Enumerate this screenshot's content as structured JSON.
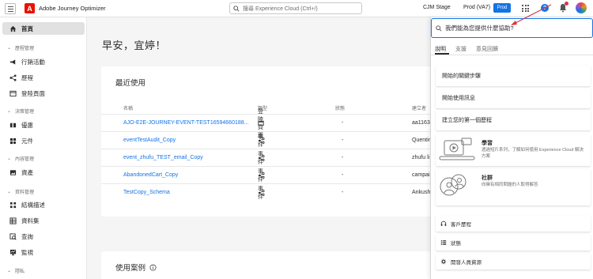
{
  "header": {
    "app_name": "Adobe Journey Optimizer",
    "logo_letter": "A",
    "search_placeholder": "搜尋 Experience Cloud (Ctrl+/)",
    "org": "CJM Stage",
    "sandbox": "Prod (VA7)",
    "sandbox_badge": "Prod",
    "help_glyph": "?"
  },
  "sidebar": {
    "home": "首頁",
    "groups": [
      {
        "label": "歷程管理",
        "items": [
          "行銷活動",
          "歷程",
          "登陸頁面"
        ]
      },
      {
        "label": "決策管理",
        "items": [
          "優惠",
          "元件"
        ]
      },
      {
        "label": "內容管理",
        "items": [
          "資產"
        ]
      },
      {
        "label": "資料管理",
        "items": [
          "結構描述",
          "資料集",
          "查詢",
          "監視"
        ]
      },
      {
        "label": "隱私"
      }
    ]
  },
  "main": {
    "greeting": "早安，宜婷！",
    "recent": {
      "title": "最近使用",
      "columns": [
        "名稱",
        "類型",
        "狀態",
        "建立者"
      ],
      "rows": [
        {
          "name": "AJO-E2E-JOURNEY-EVENT-TEST16594660188...",
          "type": "登陸頁面",
          "status": "-",
          "creator": "aa1163..."
        },
        {
          "name": "eventTestAudit_Copy",
          "type": "事件",
          "status": "-",
          "creator": "Quentin"
        },
        {
          "name": "event_zhufu_TEST_email_Copy",
          "type": "事件",
          "status": "-",
          "creator": "zhufu li"
        },
        {
          "name": "AbandonedCart_Copy",
          "type": "事件",
          "status": "-",
          "creator": "campai..."
        },
        {
          "name": "TestCopy_Schema",
          "type": "事件",
          "status": "-",
          "creator": "Ankush"
        }
      ]
    },
    "use_cases": {
      "title": "使用案例"
    }
  },
  "help_panel": {
    "search_value": "我們能為您提供什麼協助?",
    "tabs": [
      "說明",
      "支援",
      "意見回饋"
    ],
    "links": [
      "開始的關鍵步驟",
      "開始使用訊息",
      "建立您的第一個歷程"
    ],
    "learn": {
      "title": "學習",
      "desc": "透過短片系列，了解如何使用 Experience Cloud 解決方案"
    },
    "community": {
      "title": "社群",
      "desc": "向擁有相同問題的人取得解答"
    },
    "bottom_items": [
      "客戶歷程",
      "狀態",
      "開發人員資源"
    ]
  },
  "colors": {
    "accent": "#1473e6",
    "adobe_red": "#eb1000",
    "arrow": "#d7373f"
  }
}
